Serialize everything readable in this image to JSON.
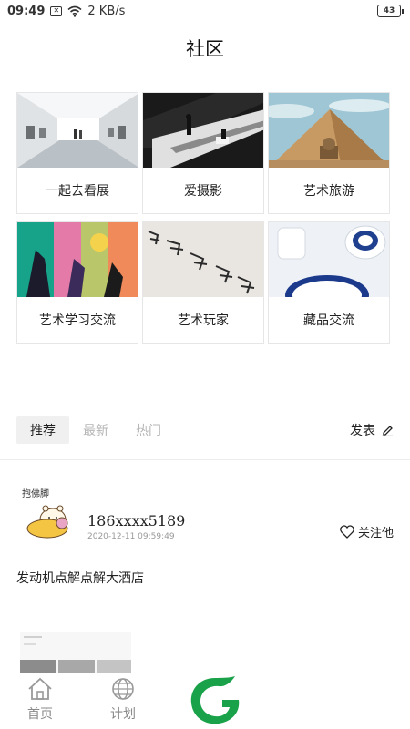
{
  "status": {
    "time": "09:49",
    "notification_badge": "✕",
    "speed": "2 KB/s",
    "battery": "43"
  },
  "header": {
    "title": "社区"
  },
  "categories": [
    {
      "label": "一起去看展",
      "icon": "gallery-photo"
    },
    {
      "label": "爱摄影",
      "icon": "escalator-photo"
    },
    {
      "label": "艺术旅游",
      "icon": "pyramid-photo"
    },
    {
      "label": "艺术学习交流",
      "icon": "abstract-painting-photo"
    },
    {
      "label": "艺术玩家",
      "icon": "flying-chairs-photo"
    },
    {
      "label": "藏品交流",
      "icon": "porcelain-photo"
    }
  ],
  "tabs": {
    "items": [
      {
        "label": "推荐",
        "active": true
      },
      {
        "label": "最新",
        "active": false
      },
      {
        "label": "热门",
        "active": false
      }
    ],
    "publish_label": "发表"
  },
  "post": {
    "avatar_text": "抱佛脚",
    "username": "186xxxx5189",
    "time": "2020-12-11 09:59:49",
    "follow_label": "关注他",
    "content": "发动机点解点解大酒店"
  },
  "bottom_nav": {
    "items": [
      {
        "label": "首页",
        "icon": "home-icon"
      },
      {
        "label": "计划",
        "icon": "globe-icon"
      }
    ]
  },
  "colors": {
    "brand_green": "#1aa24a",
    "tab_active_bg": "#f0f0f0",
    "inactive_text": "#b5b5b5"
  }
}
